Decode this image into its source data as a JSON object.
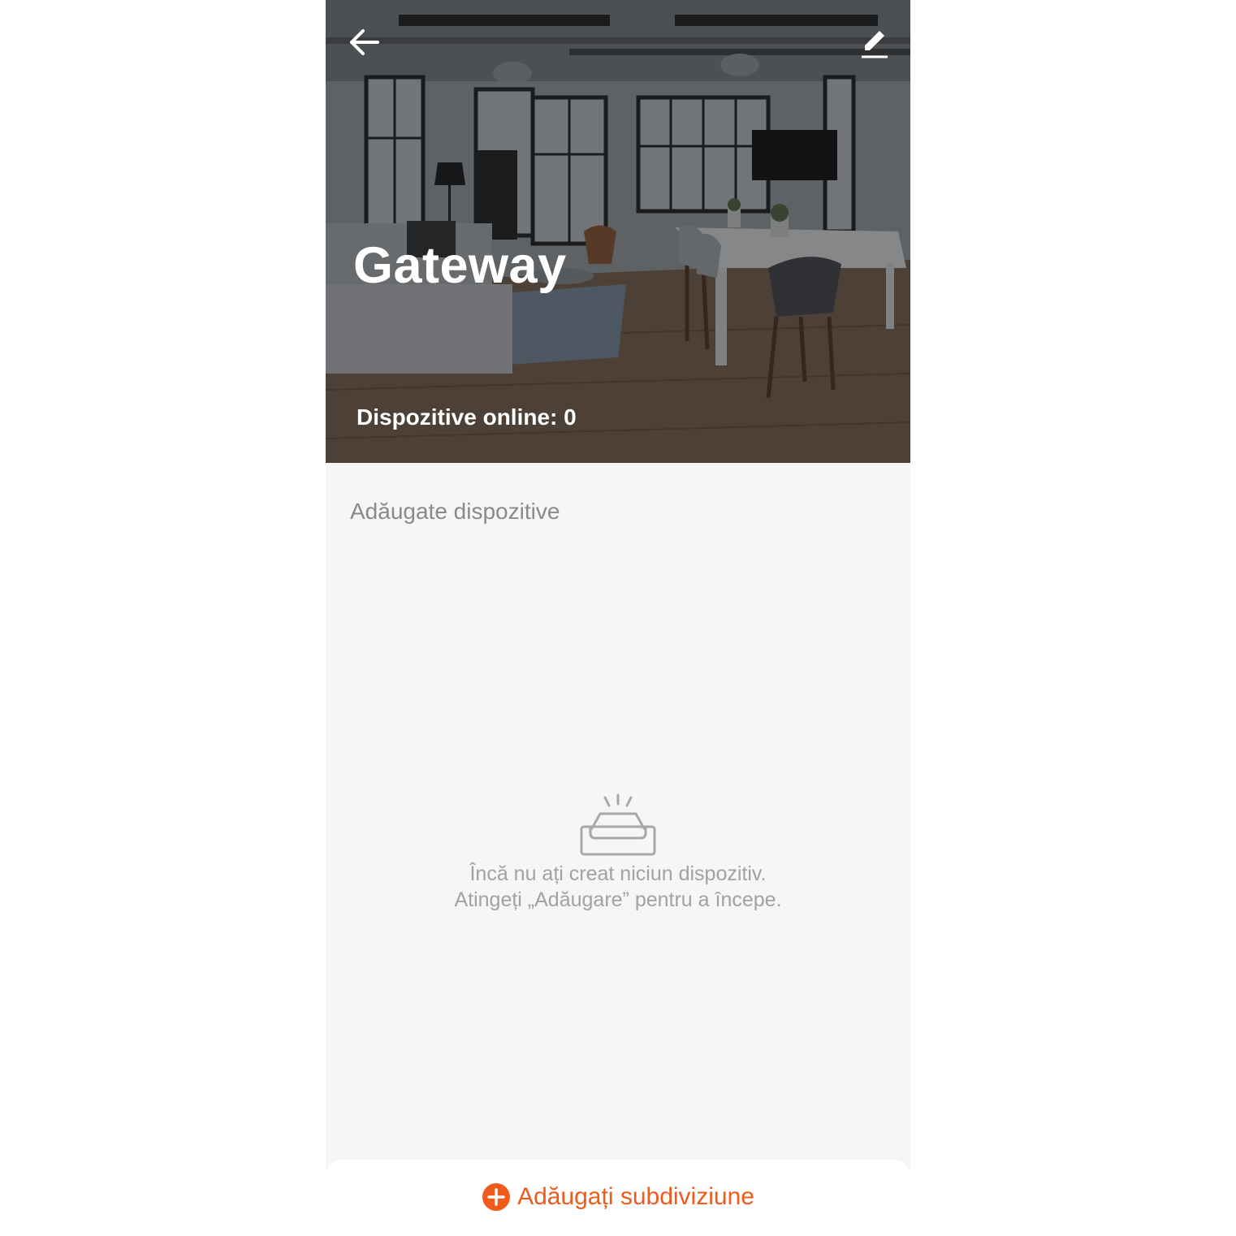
{
  "header": {
    "title": "Gateway",
    "online_label": "Dispozitive online: 0",
    "back_icon": "arrow-left-icon",
    "edit_icon": "pencil-icon"
  },
  "devices_section": {
    "label": "Adăugate dispozitive"
  },
  "empty_state": {
    "icon": "empty-tray-icon",
    "line1": "Încă nu ați creat niciun dispozitiv.",
    "line2": "Atingeți „Adăugare” pentru a începe."
  },
  "footer": {
    "add_label": "Adăugați subdiviziune",
    "add_icon": "plus-circle-icon"
  },
  "colors": {
    "accent": "#f05a1a",
    "background": "#f6f6f6",
    "muted_text": "#8a8a8a"
  }
}
